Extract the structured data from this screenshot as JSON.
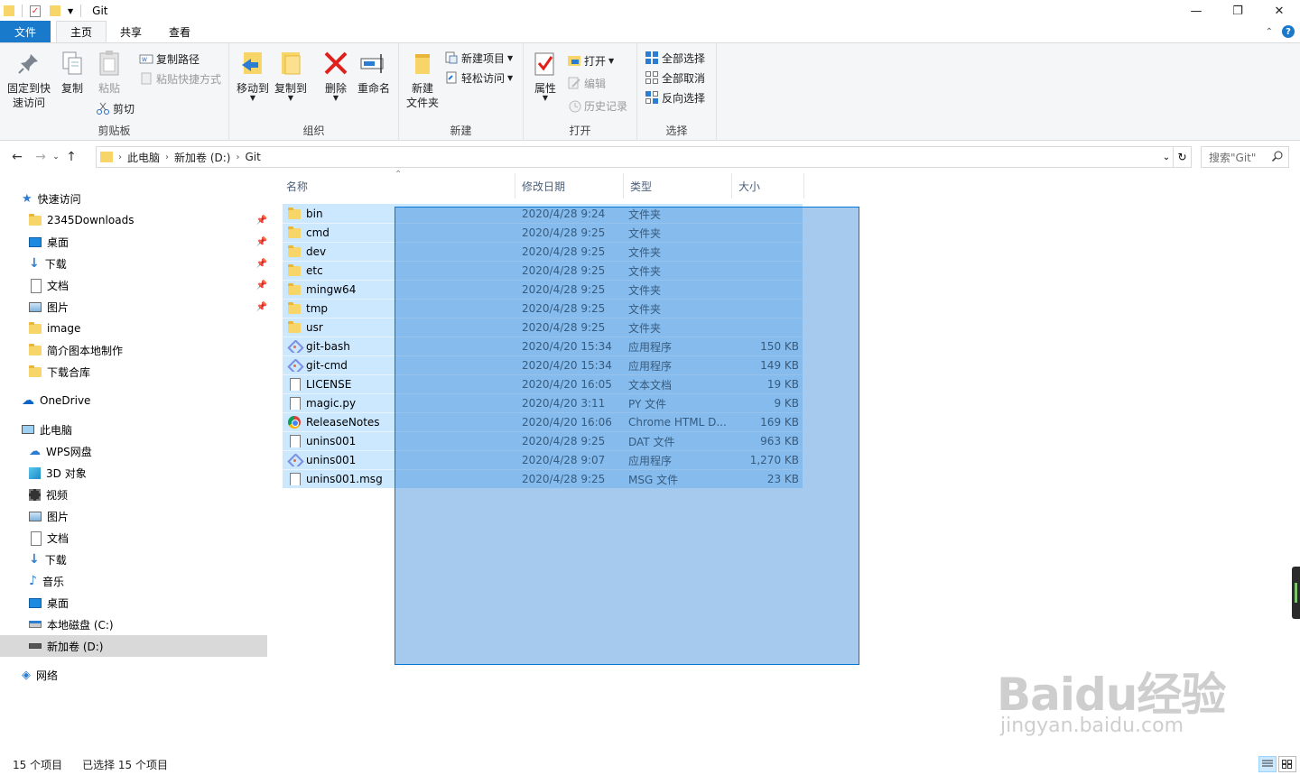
{
  "window": {
    "title": "Git",
    "controls": [
      "minimize-icon",
      "maximize-icon",
      "close-icon"
    ]
  },
  "ribbon_tabs": [
    {
      "label": "文件"
    },
    {
      "label": "主页"
    },
    {
      "label": "共享"
    },
    {
      "label": "查看"
    }
  ],
  "ribbon": {
    "clipboard": {
      "group_label": "剪贴板",
      "pin_quick_access": "固定到快\n速访问",
      "pin_line1": "固定到快",
      "pin_line2": "速访问",
      "copy": "复制",
      "paste": "粘贴",
      "copy_path": "复制路径",
      "paste_shortcut": "粘贴快捷方式",
      "cut": "剪切"
    },
    "organize": {
      "group_label": "组织",
      "move_to": "移动到",
      "copy_to": "复制到",
      "delete": "删除",
      "rename": "重命名"
    },
    "new": {
      "group_label": "新建",
      "new_folder_line1": "新建",
      "new_folder_line2": "文件夹",
      "new_item": "新建项目",
      "easy_access": "轻松访问"
    },
    "open": {
      "group_label": "打开",
      "properties": "属性",
      "open": "打开",
      "edit": "编辑",
      "history": "历史记录"
    },
    "select": {
      "group_label": "选择",
      "select_all": "全部选择",
      "select_none": "全部取消",
      "invert": "反向选择"
    }
  },
  "address": {
    "crumbs": [
      "此电脑",
      "新加卷 (D:)",
      "Git"
    ],
    "search_placeholder": "搜索\"Git\""
  },
  "nav": {
    "quick_access": "快速访问",
    "quick_items": [
      {
        "label": "2345Downloads",
        "pinned": true
      },
      {
        "label": "桌面",
        "pinned": true
      },
      {
        "label": "下载",
        "pinned": true
      },
      {
        "label": "文档",
        "pinned": true
      },
      {
        "label": "图片",
        "pinned": true
      },
      {
        "label": "image",
        "pinned": false
      },
      {
        "label": "简介图本地制作",
        "pinned": false
      },
      {
        "label": "下载合库",
        "pinned": false
      }
    ],
    "onedrive": "OneDrive",
    "this_pc": "此电脑",
    "pc_items": [
      {
        "label": "WPS网盘"
      },
      {
        "label": "3D 对象"
      },
      {
        "label": "视频"
      },
      {
        "label": "图片"
      },
      {
        "label": "文档"
      },
      {
        "label": "下载"
      },
      {
        "label": "音乐"
      },
      {
        "label": "桌面"
      },
      {
        "label": "本地磁盘 (C:)"
      },
      {
        "label": "新加卷 (D:)"
      }
    ],
    "network": "网络"
  },
  "columns": {
    "name": "名称",
    "date": "修改日期",
    "type": "类型",
    "size": "大小"
  },
  "files": [
    {
      "name": "bin",
      "date": "2020/4/28 9:24",
      "type": "文件夹",
      "size": "",
      "icon": "folder"
    },
    {
      "name": "cmd",
      "date": "2020/4/28 9:25",
      "type": "文件夹",
      "size": "",
      "icon": "folder"
    },
    {
      "name": "dev",
      "date": "2020/4/28 9:25",
      "type": "文件夹",
      "size": "",
      "icon": "folder"
    },
    {
      "name": "etc",
      "date": "2020/4/28 9:25",
      "type": "文件夹",
      "size": "",
      "icon": "folder"
    },
    {
      "name": "mingw64",
      "date": "2020/4/28 9:25",
      "type": "文件夹",
      "size": "",
      "icon": "folder"
    },
    {
      "name": "tmp",
      "date": "2020/4/28 9:25",
      "type": "文件夹",
      "size": "",
      "icon": "folder"
    },
    {
      "name": "usr",
      "date": "2020/4/28 9:25",
      "type": "文件夹",
      "size": "",
      "icon": "folder"
    },
    {
      "name": "git-bash",
      "date": "2020/4/20 15:34",
      "type": "应用程序",
      "size": "150 KB",
      "icon": "git"
    },
    {
      "name": "git-cmd",
      "date": "2020/4/20 15:34",
      "type": "应用程序",
      "size": "149 KB",
      "icon": "git"
    },
    {
      "name": "LICENSE",
      "date": "2020/4/20 16:05",
      "type": "文本文档",
      "size": "19 KB",
      "icon": "doc"
    },
    {
      "name": "magic.py",
      "date": "2020/4/20 3:11",
      "type": "PY 文件",
      "size": "9 KB",
      "icon": "doc"
    },
    {
      "name": "ReleaseNotes",
      "date": "2020/4/20 16:06",
      "type": "Chrome HTML D...",
      "size": "169 KB",
      "icon": "chrome"
    },
    {
      "name": "unins001",
      "date": "2020/4/28 9:25",
      "type": "DAT 文件",
      "size": "963 KB",
      "icon": "doc"
    },
    {
      "name": "unins001",
      "date": "2020/4/28 9:07",
      "type": "应用程序",
      "size": "1,270 KB",
      "icon": "git"
    },
    {
      "name": "unins001.msg",
      "date": "2020/4/28 9:25",
      "type": "MSG 文件",
      "size": "23 KB",
      "icon": "doc"
    }
  ],
  "status": {
    "item_count": "15 个项目",
    "selected_count": "已选择 15 个项目"
  },
  "watermark": {
    "main": "Baidu经验",
    "sub": "jingyan.baidu.com"
  },
  "colors": {
    "file_tab": "#1979ca",
    "selection": "#cce8ff",
    "marquee": "#0078d7"
  }
}
